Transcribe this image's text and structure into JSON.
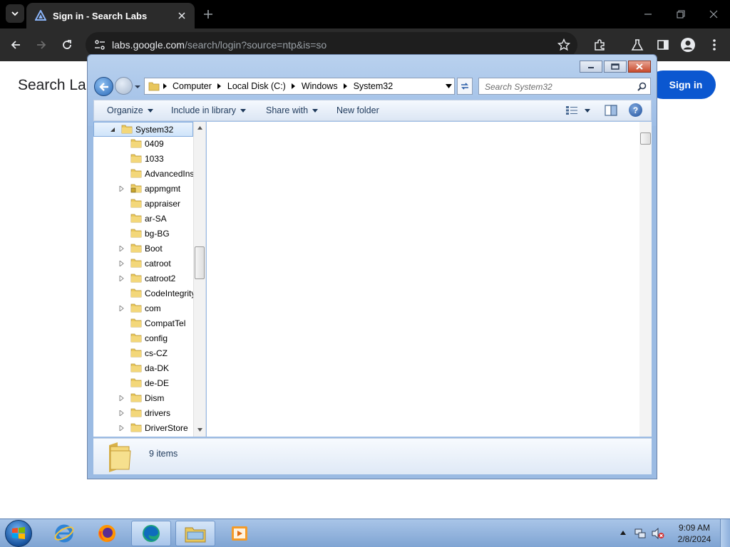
{
  "browser": {
    "tab_title": "Sign in - Search Labs",
    "url_host": "labs.google.com",
    "url_path": "/search/login?source=ntp&is=so"
  },
  "page": {
    "title": "Search Labs",
    "signin_label": "Sign in",
    "signin_color": "#0b57d0"
  },
  "explorer": {
    "breadcrumb": [
      "Computer",
      "Local Disk (C:)",
      "Windows",
      "System32"
    ],
    "search_placeholder": "Search System32",
    "toolbar": {
      "organize": "Organize",
      "include_in_library": "Include in library",
      "share_with": "Share with",
      "new_folder": "New folder",
      "help": "?"
    },
    "tree": [
      {
        "label": "System32",
        "expander": "expanded",
        "selected": true,
        "indent": 0
      },
      {
        "label": "0409",
        "expander": "none",
        "indent": 1
      },
      {
        "label": "1033",
        "expander": "none",
        "indent": 1
      },
      {
        "label": "AdvancedInstallers",
        "expander": "none",
        "indent": 1
      },
      {
        "label": "appmgmt",
        "expander": "collapsed",
        "locked": true,
        "indent": 1
      },
      {
        "label": "appraiser",
        "expander": "none",
        "indent": 1
      },
      {
        "label": "ar-SA",
        "expander": "none",
        "indent": 1
      },
      {
        "label": "bg-BG",
        "expander": "none",
        "indent": 1
      },
      {
        "label": "Boot",
        "expander": "collapsed",
        "indent": 1
      },
      {
        "label": "catroot",
        "expander": "collapsed",
        "indent": 1
      },
      {
        "label": "catroot2",
        "expander": "collapsed",
        "indent": 1
      },
      {
        "label": "CodeIntegrity",
        "expander": "none",
        "indent": 1
      },
      {
        "label": "com",
        "expander": "collapsed",
        "indent": 1
      },
      {
        "label": "CompatTel",
        "expander": "none",
        "indent": 1
      },
      {
        "label": "config",
        "expander": "none",
        "indent": 1
      },
      {
        "label": "cs-CZ",
        "expander": "none",
        "indent": 1
      },
      {
        "label": "da-DK",
        "expander": "none",
        "indent": 1
      },
      {
        "label": "de-DE",
        "expander": "none",
        "indent": 1
      },
      {
        "label": "Dism",
        "expander": "collapsed",
        "indent": 1
      },
      {
        "label": "drivers",
        "expander": "collapsed",
        "indent": 1
      },
      {
        "label": "DriverStore",
        "expander": "collapsed",
        "indent": 1
      }
    ],
    "status_items": "9 items"
  },
  "taskbar": {
    "apps": [
      "internet-explorer",
      "firefox",
      "edge",
      "file-explorer",
      "media-player"
    ],
    "clock_time": "9:09 AM",
    "clock_date": "2/8/2024"
  }
}
